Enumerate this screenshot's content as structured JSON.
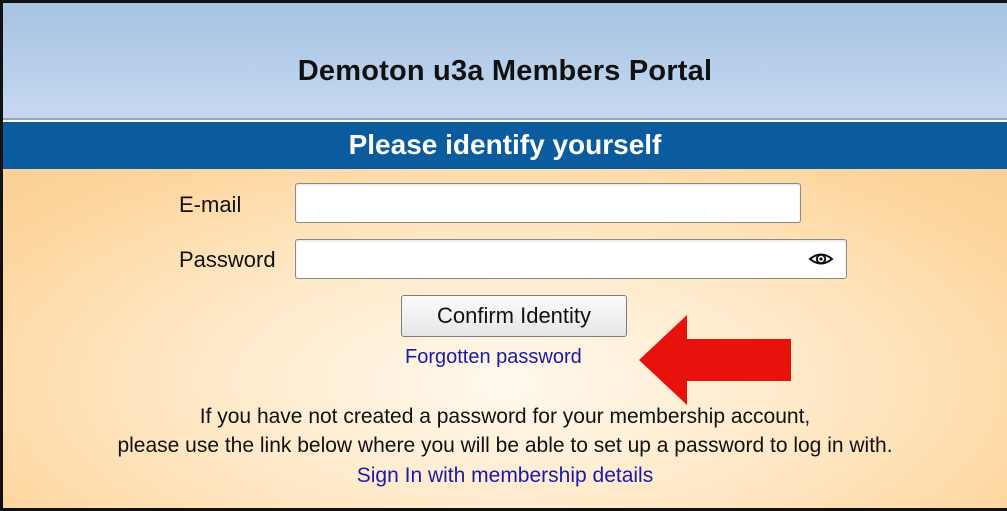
{
  "header": {
    "title": "Demoton u3a Members Portal",
    "subtitle": "Please identify yourself",
    "band_color": "#0b5c9e"
  },
  "form": {
    "email_label": "E-mail",
    "email_value": "",
    "password_label": "Password",
    "password_value": "",
    "password_toggle_icon": "eye-icon",
    "confirm_label": "Confirm Identity",
    "forgot_label": "Forgotten password",
    "link_color": "#1a1aa6"
  },
  "annotation": {
    "arrow_icon": "red-arrow-icon",
    "arrow_color": "#e8120c"
  },
  "info": {
    "line1": "If you have not created a password for your membership account,",
    "line2": "please use the link below where you will be able to set up a password to log in with.",
    "signin_label": "Sign In with membership details"
  }
}
